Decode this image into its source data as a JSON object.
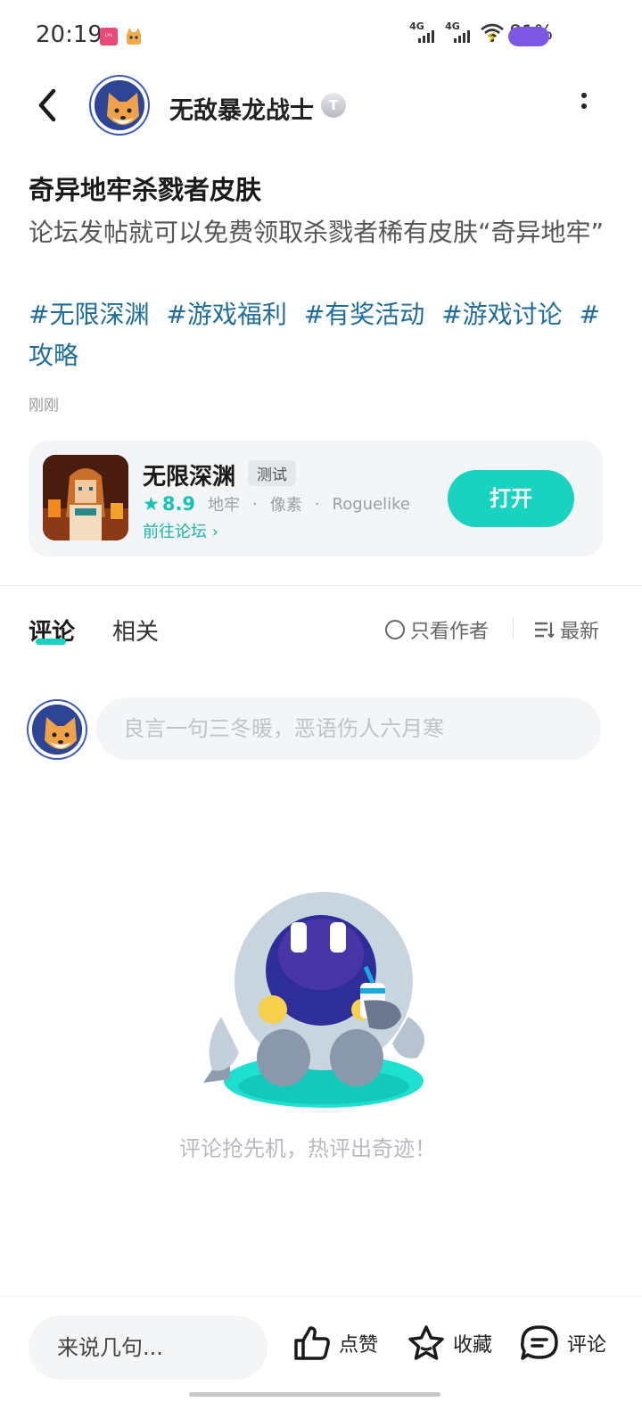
{
  "status_bar": {
    "time": "20:19",
    "network1": "4G",
    "network2": "4G",
    "battery": "81%",
    "battery_level": 0.81
  },
  "header": {
    "author_name": "无敌暴龙战士",
    "badge_letter": "T"
  },
  "post": {
    "title": "奇异地牢杀戮者皮肤",
    "body": "论坛发帖就可以免费领取杀戮者稀有皮肤“奇异地牢”",
    "tags": [
      "#无限深渊",
      "#游戏福利",
      "#有奖活动",
      "#游戏讨论",
      "#攻略"
    ],
    "time": "刚刚"
  },
  "game": {
    "name": "无限深渊",
    "status_tag": "测试",
    "rating": "8.9",
    "categories": [
      "地牢",
      "像素",
      "Roguelike"
    ],
    "forum_link": "前往论坛",
    "open_label": "打开"
  },
  "tabs": {
    "comment": "评论",
    "related": "相关",
    "author_only": "只看作者",
    "sort": "最新"
  },
  "comment_input": {
    "placeholder": "良言一句三冬暖，恶语伤人六月寒"
  },
  "empty_state": {
    "text": "评论抢先机，热评出奇迹！"
  },
  "bottom_bar": {
    "input_label": "来说几句...",
    "like": "点赞",
    "favorite": "收藏",
    "comment": "评论"
  },
  "colors": {
    "accent": "#19d3c1",
    "tag": "#1e6d9c"
  }
}
